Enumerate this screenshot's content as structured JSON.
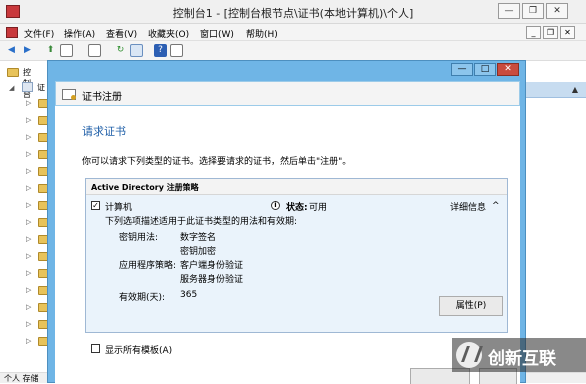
{
  "mmc": {
    "title": "控制台1 - [控制台根节点\\证书(本地计算机)\\个人]",
    "window_buttons": {
      "minimize": "—",
      "restore": "❐",
      "close": "✕"
    },
    "menu": [
      "文件(F)",
      "操作(A)",
      "查看(V)",
      "收藏夹(O)",
      "窗口(W)",
      "帮助(H)"
    ],
    "inner_buttons": {
      "minimize": "_",
      "restore": "❐",
      "close": "✕"
    },
    "tree": {
      "root_label": "控制台",
      "cert_label": "证"
    },
    "status_text": "个人 存储"
  },
  "dialog": {
    "title": "证书注册",
    "buttons": {
      "minimize": "—",
      "maximize": "□",
      "close": "✕"
    },
    "heading": "请求证书",
    "description": "你可以请求下列类型的证书。选择要请求的证书，然后单击\"注册\"。",
    "policy": {
      "name": "Active Directory 注册策略",
      "item_label": "计算机",
      "item_checked": true,
      "status_label": "状态:",
      "status_value": "可用",
      "details_label": "详细信息",
      "details_chevron": "^",
      "intro": "下列选项描述适用于此证书类型的用法和有效期:",
      "key_usage_label": "密钥用法:",
      "key_usage_values": [
        "数字签名",
        "密钥加密"
      ],
      "app_policy_label": "应用程序策略:",
      "app_policy_values": [
        "客户端身份验证",
        "服务器身份验证"
      ],
      "validity_label": "有效期(天):",
      "validity_value": "365",
      "properties_button": "属性(P)"
    },
    "show_all_label": "显示所有模板(A)"
  },
  "watermark": {
    "text": "创新互联"
  },
  "colors": {
    "dialog_frame": "#6fb5e6",
    "heading": "#1f5fa8",
    "policy_body": "#eaf3fb"
  }
}
